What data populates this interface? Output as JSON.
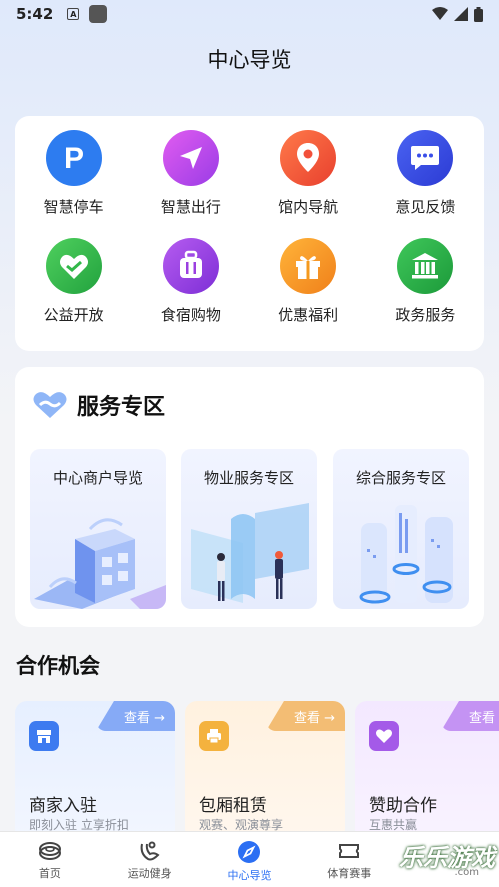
{
  "status_bar": {
    "time": "5:42",
    "icons": [
      "a-icon",
      "app-square-icon",
      "wifi-icon",
      "signal-icon",
      "battery-icon"
    ]
  },
  "page_title": "中心导览",
  "quick_menu": [
    {
      "label": "智慧停车",
      "icon": "parking-icon",
      "color": "#2d7cf0"
    },
    {
      "label": "智慧出行",
      "icon": "navigation-arrow-icon",
      "color": "#c04df0"
    },
    {
      "label": "馆内导航",
      "icon": "location-pin-icon",
      "color": "#f2503a"
    },
    {
      "label": "意见反馈",
      "icon": "chat-bubble-icon",
      "color": "#3a4ee8"
    },
    {
      "label": "公益开放",
      "icon": "heart-hands-icon",
      "color": "#32b84a"
    },
    {
      "label": "食宿购物",
      "icon": "luggage-icon",
      "color": "#9b3fe0"
    },
    {
      "label": "优惠福利",
      "icon": "gift-icon",
      "color": "#f59a1e"
    },
    {
      "label": "政务服务",
      "icon": "government-building-icon",
      "color": "#26a845"
    }
  ],
  "service_zone": {
    "title": "服务专区",
    "items": [
      {
        "label": "中心商户导览"
      },
      {
        "label": "物业服务专区"
      },
      {
        "label": "综合服务专区"
      }
    ]
  },
  "cooperation": {
    "title": "合作机会",
    "items": [
      {
        "name": "商家入驻",
        "sub": "即刻入驻 立享折扣",
        "view": "查看 →",
        "color": "#6e9cf5"
      },
      {
        "name": "包厢租赁",
        "sub": "观赛、观演尊享",
        "view": "查看 →",
        "color": "#f2b25c"
      },
      {
        "name": "赞助合作",
        "sub": "互惠共赢",
        "view": "查看",
        "color": "#b77ef0"
      }
    ]
  },
  "tab_bar": [
    {
      "label": "首页",
      "icon": "home-icon"
    },
    {
      "label": "运动健身",
      "icon": "fitness-icon"
    },
    {
      "label": "中心导览",
      "icon": "compass-icon",
      "active": true
    },
    {
      "label": "体育赛事",
      "icon": "ticket-icon"
    }
  ],
  "watermark": {
    "text": "乐乐游戏",
    "sub": ".com"
  }
}
